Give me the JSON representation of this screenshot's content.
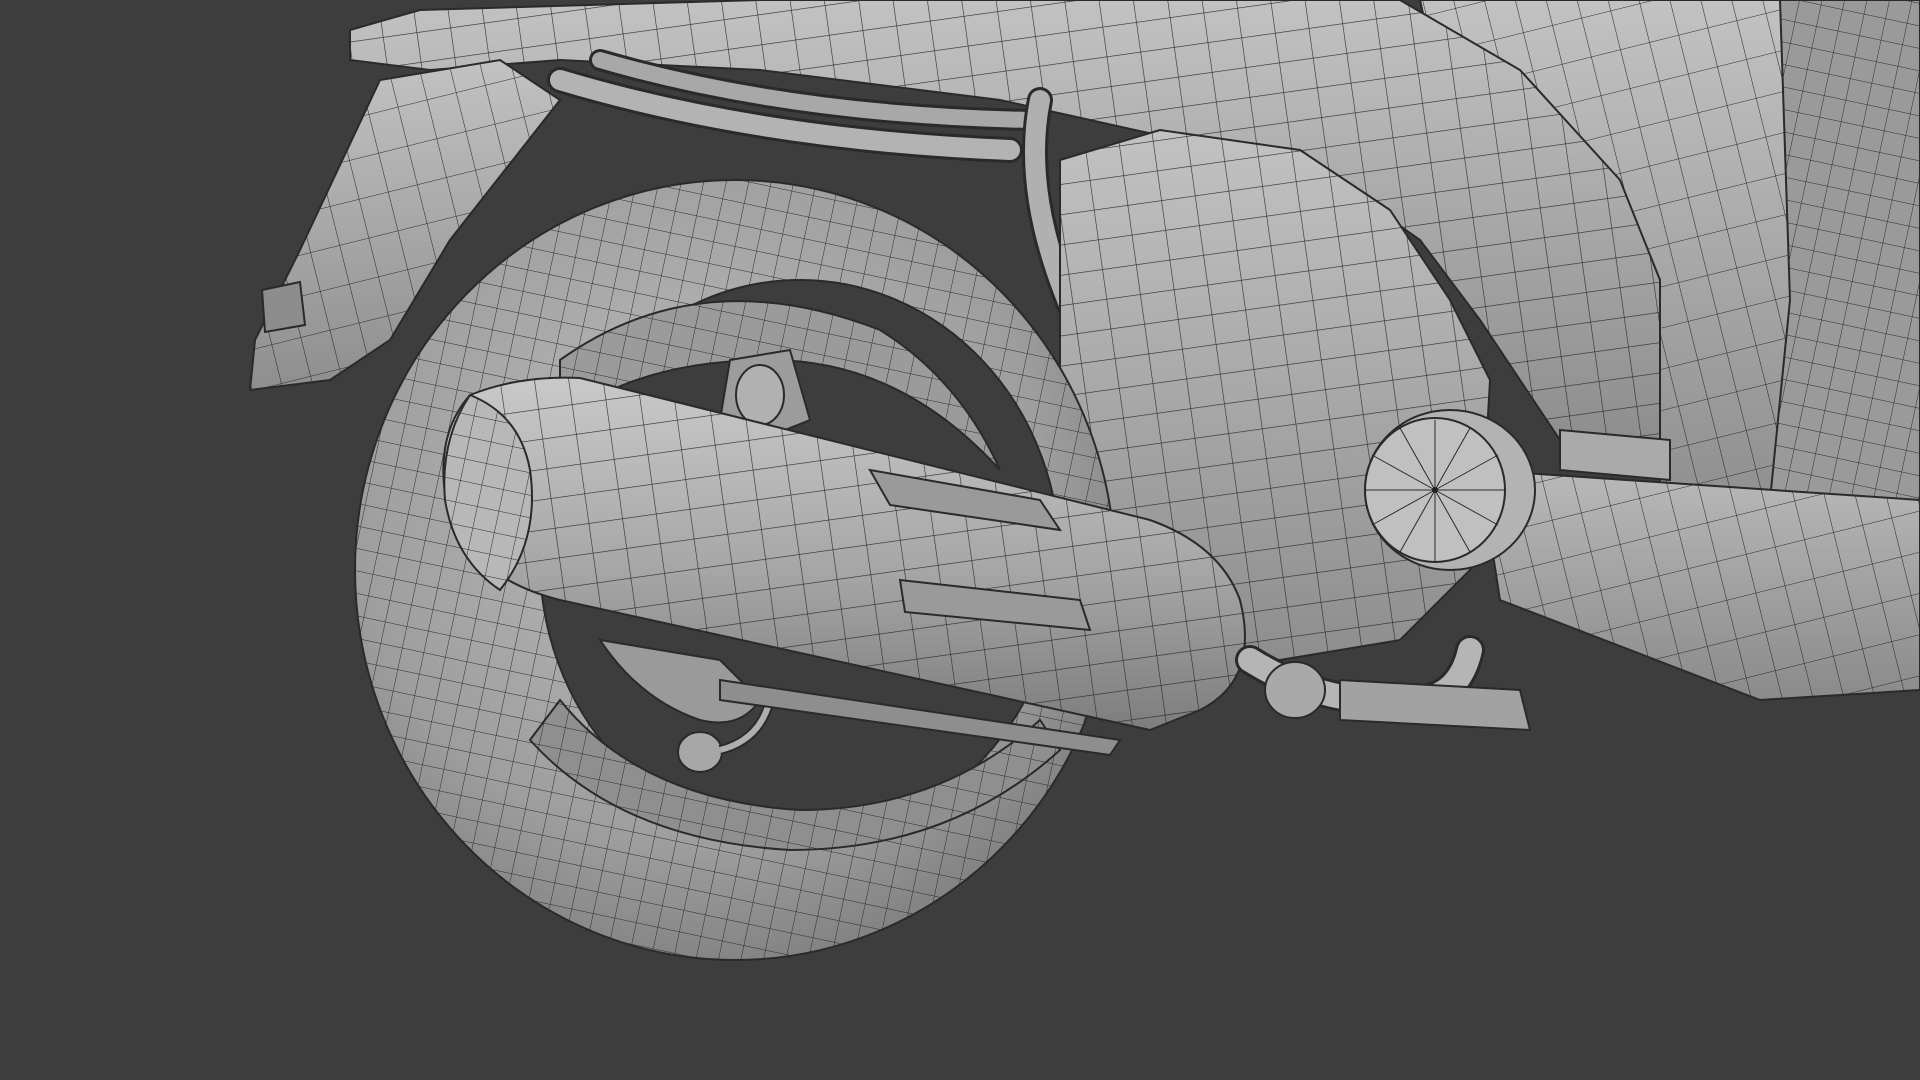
{
  "scene": {
    "background_color": "#3d3d3d",
    "mesh_color": "#a9a9a9",
    "mesh_light_color": "#c4c4c4",
    "mesh_dark_color": "#7a7a7a",
    "wire_color": "#2a2a2a",
    "display_mode": "solid-with-wireframe-overlay",
    "subject": "scooter-rear-wheel-exhaust-model"
  }
}
